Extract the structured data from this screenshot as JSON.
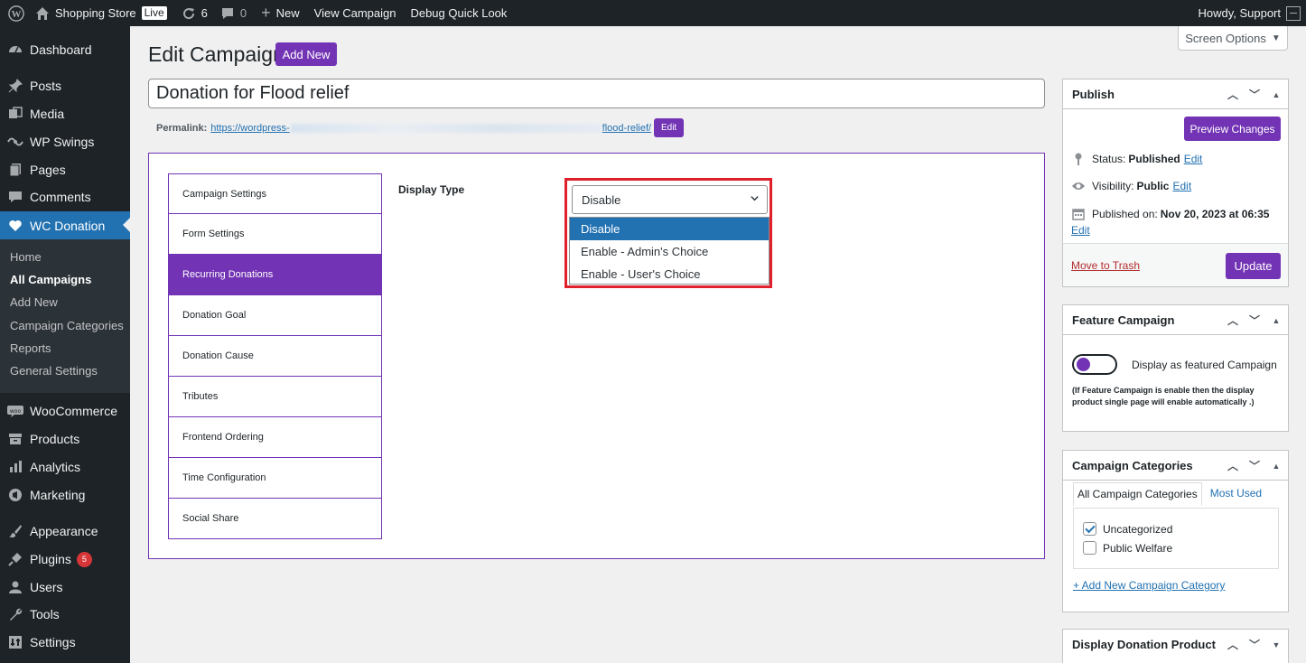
{
  "adminbar": {
    "site_name": "Shopping Store",
    "live_badge": "Live",
    "updates_count": "6",
    "comments_count": "0",
    "new_label": "New",
    "view_campaign": "View Campaign",
    "debug_quick_look": "Debug Quick Look",
    "howdy": "Howdy, Support"
  },
  "sidebar": {
    "items": [
      {
        "label": "Dashboard",
        "icon": "dashboard-icon"
      },
      {
        "label": "Posts",
        "icon": "pin-icon"
      },
      {
        "label": "Media",
        "icon": "media-icon"
      },
      {
        "label": "WP Swings",
        "icon": "swings-icon"
      },
      {
        "label": "Pages",
        "icon": "pages-icon"
      },
      {
        "label": "Comments",
        "icon": "comment-icon"
      },
      {
        "label": "WC Donation",
        "icon": "heart-icon"
      },
      {
        "label": "WooCommerce",
        "icon": "woo-icon"
      },
      {
        "label": "Products",
        "icon": "archive-icon"
      },
      {
        "label": "Analytics",
        "icon": "chart-icon"
      },
      {
        "label": "Marketing",
        "icon": "megaphone-icon"
      },
      {
        "label": "Appearance",
        "icon": "brush-icon"
      },
      {
        "label": "Plugins",
        "icon": "plug-icon",
        "badge": "5"
      },
      {
        "label": "Users",
        "icon": "user-icon"
      },
      {
        "label": "Tools",
        "icon": "wrench-icon"
      },
      {
        "label": "Settings",
        "icon": "settings-icon"
      }
    ],
    "submenu": [
      "Home",
      "All Campaigns",
      "Add New",
      "Campaign Categories",
      "Reports",
      "General Settings"
    ]
  },
  "header": {
    "title": "Edit Campaign",
    "add_new": "Add New",
    "screen_options": "Screen Options"
  },
  "post": {
    "title": "Donation for Flood relief",
    "permalink_label": "Permalink:",
    "permalink_start": "https://wordpress-",
    "permalink_end": "flood-relief/",
    "permalink_edit": "Edit"
  },
  "settings": {
    "tabs": [
      "Campaign Settings",
      "Form Settings",
      "Recurring Donations",
      "Donation Goal",
      "Donation Cause",
      "Tributes",
      "Frontend Ordering",
      "Time Configuration",
      "Social Share"
    ],
    "active_tab": "Recurring Donations",
    "display_type_label": "Display Type",
    "display_type_value": "Disable",
    "display_type_options": [
      "Disable",
      "Enable - Admin's Choice",
      "Enable - User's Choice"
    ]
  },
  "publish": {
    "title": "Publish",
    "preview_changes": "Preview Changes",
    "status_label": "Status:",
    "status_value": "Published",
    "visibility_label": "Visibility:",
    "visibility_value": "Public",
    "published_on_label": "Published on:",
    "published_on_value": "Nov 20, 2023 at 06:35",
    "edit": "Edit",
    "move_to_trash": "Move to Trash",
    "update": "Update"
  },
  "feature": {
    "title": "Feature Campaign",
    "toggle_label": "Display as featured Campaign",
    "note": "(If Feature Campaign is enable then the display product single page will enable automatically .)"
  },
  "categories": {
    "title": "Campaign Categories",
    "tab_all": "All Campaign Categories",
    "tab_most_used": "Most Used",
    "items": [
      {
        "label": "Uncategorized",
        "checked": true
      },
      {
        "label": "Public Welfare",
        "checked": false
      }
    ],
    "add_new": "+ Add New Campaign Category"
  },
  "donation_product": {
    "title": "Display Donation Product"
  },
  "colors": {
    "accent": "#7233b4",
    "wp_blue": "#2271b1",
    "highlight_red": "#e0202b",
    "adminbar_bg": "#1d2327"
  }
}
